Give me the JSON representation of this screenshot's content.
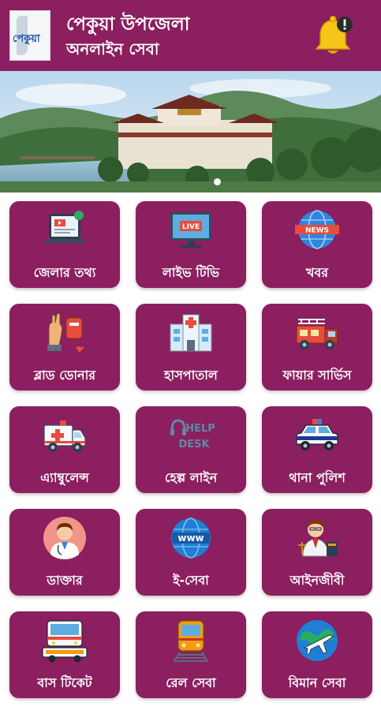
{
  "header": {
    "logo_text": "পেকুয়া",
    "title": "পেকুয়া উপজেলা",
    "subtitle": "অনলাইন সেবা",
    "icons": [
      "app-logo",
      "notification-bell-icon"
    ]
  },
  "banner": {
    "slide_count": 1,
    "active_slide": 1
  },
  "colors": {
    "primary": "#8b1f5f",
    "bell": "#f5c518",
    "tile_text": "#ffffff"
  },
  "tiles": [
    {
      "label": "জেলার তথ্য",
      "icon": "district-info-icon"
    },
    {
      "label": "লাইভ টিভি",
      "icon": "live-tv-icon"
    },
    {
      "label": "খবর",
      "icon": "news-icon"
    },
    {
      "label": "ব্লাড ডোনার",
      "icon": "blood-donor-icon"
    },
    {
      "label": "হাসপাতাল",
      "icon": "hospital-icon"
    },
    {
      "label": "ফায়ার সার্ভিস",
      "icon": "fire-truck-icon"
    },
    {
      "label": "এ্যাম্বুলেন্স",
      "icon": "ambulance-icon"
    },
    {
      "label": "হেল্প লাইন",
      "icon": "help-desk-icon",
      "icon_text": "HELP DESK"
    },
    {
      "label": "থানা পুলিশ",
      "icon": "police-car-icon"
    },
    {
      "label": "ডাক্তার",
      "icon": "doctor-icon"
    },
    {
      "label": "ই-সেবা",
      "icon": "www-icon",
      "icon_text": "www"
    },
    {
      "label": "আইনজীবী",
      "icon": "lawyer-icon"
    },
    {
      "label": "বাস টিকেট",
      "icon": "bus-icon"
    },
    {
      "label": "রেল সেবা",
      "icon": "train-icon"
    },
    {
      "label": "বিমান সেবা",
      "icon": "airplane-icon"
    }
  ]
}
